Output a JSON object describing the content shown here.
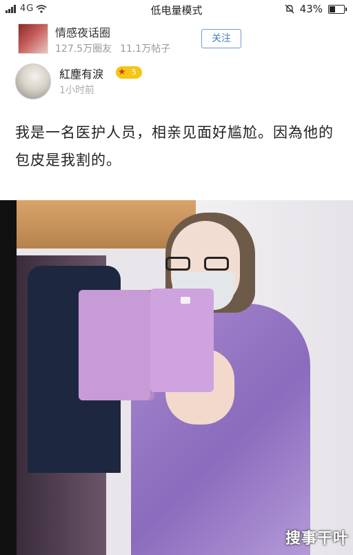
{
  "status_bar": {
    "signal_text": "4G",
    "mode_text": "低电量模式",
    "battery_percent": "43%",
    "battery_level": 0.43,
    "icons": [
      "signal-icon",
      "wifi-icon",
      "alarm-off-icon",
      "battery-icon"
    ]
  },
  "group": {
    "name": "情感夜话圈",
    "members": "127.5万圈友",
    "posts": "11.1万帖子",
    "follow_label": "关注"
  },
  "author": {
    "name": "紅塵有淚",
    "level": "5",
    "time": "1小时前"
  },
  "post": {
    "text": "我是一名医护人员，相亲见面好尴尬。因為他的包皮是我割的。"
  },
  "photo": {
    "watermark": "搜事干叶"
  },
  "colors": {
    "accent": "#4a7fc0",
    "badge": "#f5c518"
  }
}
